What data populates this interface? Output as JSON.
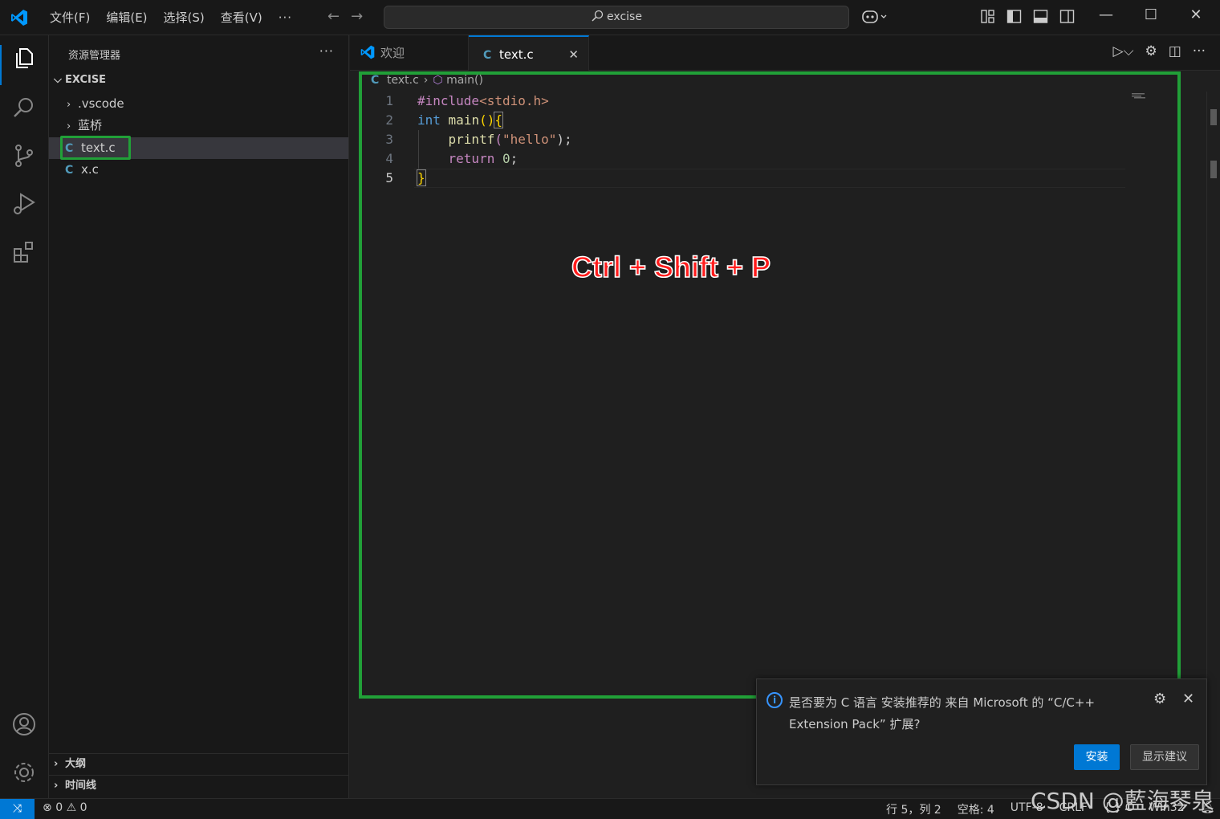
{
  "titlebar": {
    "menu": [
      "文件(F)",
      "编辑(E)",
      "选择(S)",
      "查看(V)"
    ],
    "more": "···",
    "search_text": "excise",
    "colors": {
      "accent": "#0078d4",
      "logo": "#0098ff"
    }
  },
  "sidebar": {
    "title": "资源管理器",
    "more": "···",
    "root": "EXCISE",
    "items": [
      {
        "type": "folder",
        "label": ".vscode"
      },
      {
        "type": "folder",
        "label": "蓝桥"
      },
      {
        "type": "file",
        "icon": "C",
        "label": "text.c",
        "selected": true
      },
      {
        "type": "file",
        "icon": "C",
        "label": "x.c"
      }
    ],
    "sections": [
      "大纲",
      "时间线"
    ]
  },
  "tabs": [
    {
      "label": "欢迎",
      "active": false
    },
    {
      "label": "text.c",
      "icon": "C",
      "active": true,
      "close": "✕"
    }
  ],
  "breadcrumb": {
    "file": "text.c",
    "file_icon": "C",
    "symbol": "main()"
  },
  "code": {
    "line_numbers": [
      "1",
      "2",
      "3",
      "4",
      "5"
    ],
    "l1_pre": "#include",
    "l1_inc": "<stdio.h>",
    "l2_type": "int",
    "l2_fn": "main",
    "l2_paren": "()",
    "l2_brace": "{",
    "l3_fn": "printf",
    "l3_open": "(",
    "l3_str": "\"hello\"",
    "l3_close": ");",
    "l4_kw": "return",
    "l4_num": "0",
    "l4_semi": ";",
    "l5_brace": "}"
  },
  "overlay": {
    "shortcut": "Ctrl + Shift + P",
    "highlight_color": "#21a038",
    "text_color": "#ff1c1c"
  },
  "notification": {
    "line1": "是否要为 C 语言 安装推荐的 来自 Microsoft 的 “C/C++",
    "line2": "Extension Pack” 扩展?",
    "install": "安装",
    "show": "显示建议"
  },
  "statusbar": {
    "errors": "0",
    "warnings": "0",
    "position": "行 5，列 2",
    "spaces": "空格: 4",
    "encoding": "UTF-8",
    "eol": "CRLF",
    "language": "C",
    "platform": "Win32"
  },
  "watermark": "CSDN @藍海琴泉"
}
